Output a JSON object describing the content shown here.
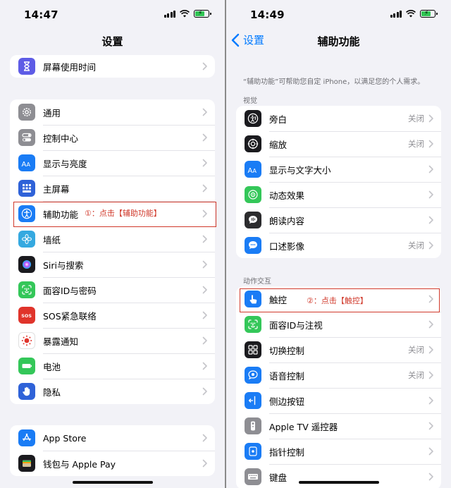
{
  "left": {
    "time": "14:47",
    "title": "设置",
    "group_top": [
      {
        "label": "屏幕使用时间",
        "icon": "hourglass-icon",
        "color": "#5e5ce6"
      }
    ],
    "group_main": [
      {
        "label": "通用",
        "icon": "gear-icon",
        "color": "#8e8e93"
      },
      {
        "label": "控制中心",
        "icon": "toggles-icon",
        "color": "#8e8e93"
      },
      {
        "label": "显示与亮度",
        "icon": "text-size-icon",
        "color": "#1a7cf5"
      },
      {
        "label": "主屏幕",
        "icon": "home-grid-icon",
        "color": "#2f62d8"
      },
      {
        "label": "辅助功能",
        "icon": "accessibility-icon",
        "color": "#1a7cf5"
      },
      {
        "label": "墙纸",
        "icon": "flower-icon",
        "color": "#35a9e0"
      },
      {
        "label": "Siri与搜索",
        "icon": "siri-icon",
        "color": "#1b1b1f"
      },
      {
        "label": "面容ID与密码",
        "icon": "face-id-icon",
        "color": "#34c759"
      },
      {
        "label": "SOS紧急联络",
        "icon": "sos-icon",
        "color": "#e0342b"
      },
      {
        "label": "暴露通知",
        "icon": "exposure-icon",
        "color": "#ffffff"
      },
      {
        "label": "电池",
        "icon": "battery-icon",
        "color": "#34c759"
      },
      {
        "label": "隐私",
        "icon": "hand-icon",
        "color": "#2f62d8"
      }
    ],
    "group_store": [
      {
        "label": "App Store",
        "icon": "app-store-icon",
        "color": "#1a7cf5"
      },
      {
        "label": "钱包与 Apple Pay",
        "icon": "wallet-icon",
        "color": "#1b1b1f"
      }
    ],
    "annotation": "①：点击【辅助功能】"
  },
  "right": {
    "time": "14:49",
    "back_label": "设置",
    "title": "辅助功能",
    "description": "“辅助功能”可帮助您自定 iPhone，以满足您的个人需求。",
    "section_vision": "视觉",
    "vision": [
      {
        "label": "旁白",
        "value": "关闭",
        "icon": "voiceover-icon",
        "color": "#1b1b1f"
      },
      {
        "label": "缩放",
        "value": "关闭",
        "icon": "zoom-icon",
        "color": "#1b1b1f"
      },
      {
        "label": "显示与文字大小",
        "value": "",
        "icon": "text-size-icon",
        "color": "#1a7cf5"
      },
      {
        "label": "动态效果",
        "value": "",
        "icon": "motion-icon",
        "color": "#34c759"
      },
      {
        "label": "朗读内容",
        "value": "",
        "icon": "speech-bubble-icon",
        "color": "#2c2c2e"
      },
      {
        "label": "口述影像",
        "value": "关闭",
        "icon": "audio-description-icon",
        "color": "#1a7cf5"
      }
    ],
    "section_interaction": "动作交互",
    "interaction": [
      {
        "label": "触控",
        "value": "",
        "icon": "touch-hand-icon",
        "color": "#1a7cf5"
      },
      {
        "label": "面容ID与注视",
        "value": "",
        "icon": "face-id-icon",
        "color": "#34c759"
      },
      {
        "label": "切换控制",
        "value": "关闭",
        "icon": "switch-grid-icon",
        "color": "#1b1b1f"
      },
      {
        "label": "语音控制",
        "value": "关闭",
        "icon": "voice-control-icon",
        "color": "#1a7cf5"
      },
      {
        "label": "侧边按钮",
        "value": "",
        "icon": "side-button-icon",
        "color": "#1a7cf5"
      },
      {
        "label": "Apple TV 遥控器",
        "value": "",
        "icon": "remote-icon",
        "color": "#8e8e93"
      },
      {
        "label": "指针控制",
        "value": "",
        "icon": "pointer-icon",
        "color": "#1a7cf5"
      },
      {
        "label": "键盘",
        "value": "",
        "icon": "keyboard-icon",
        "color": "#8e8e93"
      }
    ],
    "annotation": "②：点击【触控】"
  },
  "colors": {
    "accent": "#007aff",
    "annotation_red": "#d0392b",
    "background": "#f2f2f7"
  }
}
